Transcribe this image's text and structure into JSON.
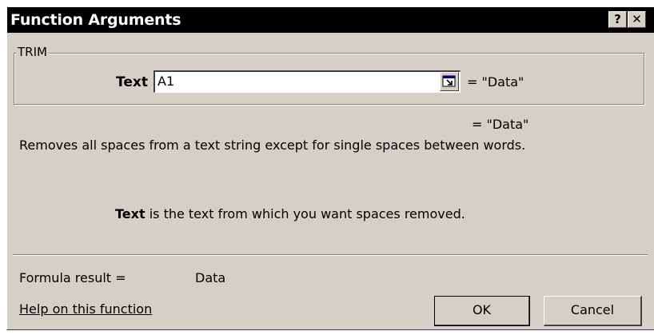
{
  "window": {
    "title": "Function Arguments",
    "help_button": "?",
    "close_button": "✕"
  },
  "function": {
    "name": "TRIM",
    "argument": {
      "label": "Text",
      "input_value": "A1",
      "evaluated_value": "= \"Data\""
    }
  },
  "result_preview": "= \"Data\"",
  "description": "Removes all spaces from a text string except for single spaces between words.",
  "argument_help": {
    "name": "Text",
    "text": " is the text from which you want spaces removed."
  },
  "formula_result": {
    "label": "Formula result =",
    "value": "Data"
  },
  "help_link": "Help on this function",
  "buttons": {
    "ok": "OK",
    "cancel": "Cancel"
  }
}
